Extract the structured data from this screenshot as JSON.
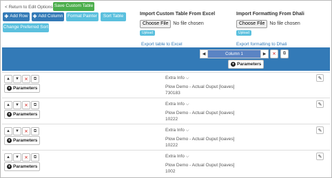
{
  "toolbar": {
    "return_label": "< Return to Edit Options",
    "save_label": "Save Custom Table",
    "add_row_label": "Add Row",
    "add_column_label": "Add Column",
    "format_painter_label": "Format Painter",
    "sort_table_label": "Sort Table",
    "change_sort_label": "Change Preferred Sort"
  },
  "import_table": {
    "heading": "Import Custom Table From Excel",
    "choose_file_label": "Choose File",
    "no_file_text": "No file chosen",
    "upload_label": "Upload",
    "export_link": "Export table to Excel"
  },
  "import_format": {
    "heading": "Import Formatting From Dhali",
    "choose_file_label": "Choose File",
    "no_file_text": "No file chosen",
    "upload_label": "Upload",
    "export_link": "Export formatting to Dhali"
  },
  "column_header": {
    "column_label": "Column 1",
    "parameters_label": "Parameters"
  },
  "rows": [
    {
      "extra_info": "Extra Info",
      "parameters_label": "Parameters",
      "line1": "Plow Demo - Actual Ouput [loaves]",
      "line2": "730183"
    },
    {
      "extra_info": "Extra Info",
      "parameters_label": "Parameters",
      "line1": "Plow Demo - Actual Ouput [loaves]",
      "line2": "10222"
    },
    {
      "extra_info": "Extra Info",
      "parameters_label": "Parameters",
      "line1": "Plow Demo - Actual Ouput [loaves]",
      "line2": "10222"
    },
    {
      "extra_info": "Extra Info",
      "parameters_label": "Parameters",
      "line1": "Plow Demo - Actual Ouput [loaves]",
      "line2": "1002"
    }
  ],
  "colors": {
    "green": "#4cae4c",
    "blue": "#337ab7",
    "cyan": "#5bc0de",
    "danger": "#d9534f"
  }
}
